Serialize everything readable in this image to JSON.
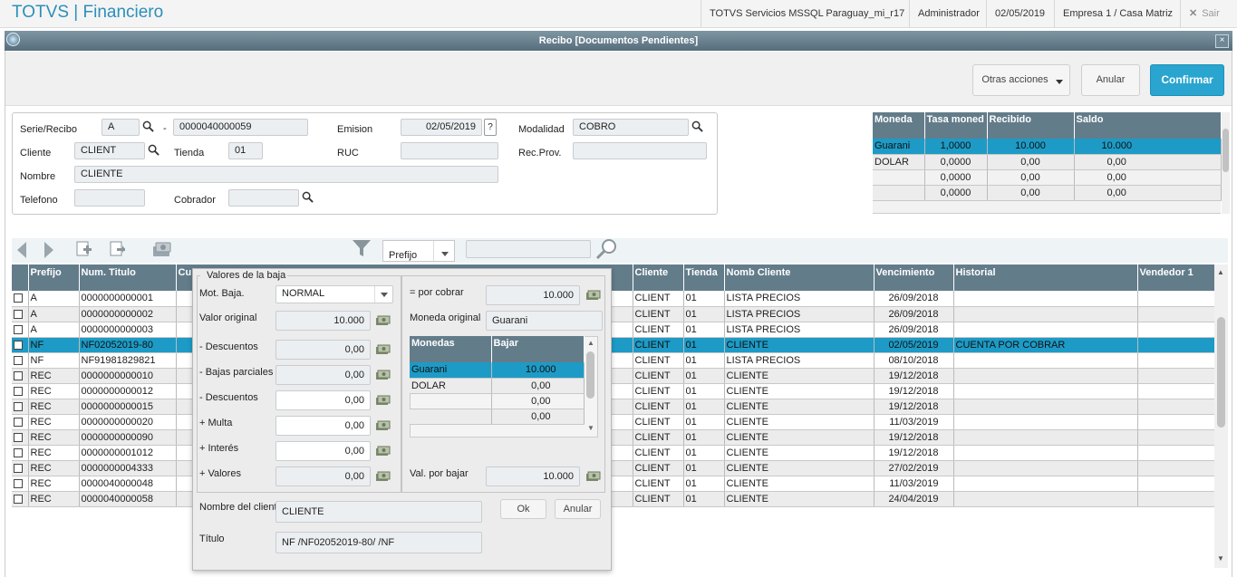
{
  "topbar": {
    "app_title": "TOTVS | Financiero",
    "server": "TOTVS Servicios MSSQL Paraguay_mi_r17",
    "user": "Administrador",
    "date": "02/05/2019",
    "company": "Empresa 1 / Casa Matriz",
    "exit": "Sair"
  },
  "window": {
    "title": "Recibo [Documentos Pendientes]"
  },
  "actions": {
    "other": "Otras acciones",
    "cancel": "Anular",
    "confirm": "Confirmar"
  },
  "form": {
    "serie_label": "Serie/Recibo",
    "serie": "A",
    "dash": "-",
    "recibo": "0000040000059",
    "emision_label": "Emision",
    "emision": "02/05/2019",
    "help": "?",
    "modalidad_label": "Modalidad",
    "modalidad": "COBRO",
    "cliente_label": "Cliente",
    "cliente": "CLIENT",
    "tienda_label": "Tienda",
    "tienda": "01",
    "ruc_label": "RUC",
    "ruc": "",
    "recprov_label": "Rec.Prov.",
    "recprov": "",
    "nombre_label": "Nombre",
    "nombre": "CLIENTE",
    "telefono_label": "Telefono",
    "telefono": "",
    "cobrador_label": "Cobrador",
    "cobrador": ""
  },
  "currency": {
    "headers": [
      "Moneda",
      "Tasa moned",
      "Recibido",
      "Saldo"
    ],
    "rows": [
      [
        "Guarani",
        "1,0000",
        "10.000",
        "10.000"
      ],
      [
        "DOLAR",
        "0,0000",
        "0,00",
        "0,00"
      ],
      [
        "",
        "0,0000",
        "0,00",
        "0,00"
      ],
      [
        "",
        "0,0000",
        "0,00",
        "0,00"
      ]
    ]
  },
  "toolbar": {
    "filter_field": "Prefijo",
    "search": ""
  },
  "grid": {
    "headers": [
      "",
      "Prefijo",
      "Num. Titulo",
      "Cu",
      "Cliente",
      "Tienda",
      "Nomb Cliente",
      "Vencimiento",
      "Historial",
      "Vendedor 1"
    ],
    "rows": [
      [
        "A",
        "0000000000001",
        "CLIENT",
        "01",
        "LISTA PRECIOS",
        "26/09/2018",
        ""
      ],
      [
        "A",
        "0000000000002",
        "CLIENT",
        "01",
        "LISTA PRECIOS",
        "26/09/2018",
        ""
      ],
      [
        "A",
        "0000000000003",
        "CLIENT",
        "01",
        "LISTA PRECIOS",
        "26/09/2018",
        ""
      ],
      [
        "NF",
        "NF02052019-80",
        "CLIENT",
        "01",
        "CLIENTE",
        "02/05/2019",
        "CUENTA POR COBRAR"
      ],
      [
        "NF",
        "NF91981829821",
        "CLIENT",
        "01",
        "LISTA PRECIOS",
        "08/10/2018",
        ""
      ],
      [
        "REC",
        "0000000000010",
        "CLIENT",
        "01",
        "CLIENTE",
        "19/12/2018",
        ""
      ],
      [
        "REC",
        "0000000000012",
        "CLIENT",
        "01",
        "CLIENTE",
        "19/12/2018",
        ""
      ],
      [
        "REC",
        "0000000000015",
        "CLIENT",
        "01",
        "CLIENTE",
        "19/12/2018",
        ""
      ],
      [
        "REC",
        "0000000000020",
        "CLIENT",
        "01",
        "CLIENTE",
        "11/03/2019",
        ""
      ],
      [
        "REC",
        "0000000000090",
        "CLIENT",
        "01",
        "CLIENTE",
        "19/12/2018",
        ""
      ],
      [
        "REC",
        "0000000001012",
        "CLIENT",
        "01",
        "CLIENTE",
        "19/12/2018",
        ""
      ],
      [
        "REC",
        "0000000004333",
        "CLIENT",
        "01",
        "CLIENTE",
        "27/02/2019",
        ""
      ],
      [
        "REC",
        "0000040000048",
        "CLIENT",
        "01",
        "CLIENTE",
        "11/03/2019",
        ""
      ],
      [
        "REC",
        "0000040000058",
        "CLIENT",
        "01",
        "CLIENTE",
        "24/04/2019",
        ""
      ]
    ]
  },
  "dialog": {
    "group_title": "Valores de la baja",
    "mot_label": "Mot. Baja.",
    "mot": "NORMAL",
    "orig_label": "Valor original",
    "orig": "10.000",
    "desc1_label": "- Descuentos",
    "desc1": "0,00",
    "bajas_label": "- Bajas parciales",
    "bajas": "0,00",
    "desc2_label": "- Descuentos",
    "desc2": "0,00",
    "multa_label": "+ Multa",
    "multa": "0,00",
    "interes_label": "+ Interés",
    "interes": "0,00",
    "valores_label": "+ Valores",
    "valores": "0,00",
    "porcobrar_label": "= por cobrar",
    "porcobrar": "10.000",
    "moneda_label": "Moneda original",
    "moneda": "Guarani",
    "mon_headers": [
      "Monedas",
      "Bajar"
    ],
    "mon_rows": [
      [
        "Guarani",
        "10.000"
      ],
      [
        "DOLAR",
        "0,00"
      ],
      [
        "",
        "0,00"
      ],
      [
        "",
        "0,00"
      ]
    ],
    "valbajar_label": "Val. por bajar",
    "valbajar": "10.000",
    "nombre_label": "Nombre del cliente",
    "nombre": "CLIENTE",
    "titulo_label": "Título",
    "titulo": "NF /NF02052019-80/  /NF",
    "ok": "Ok",
    "cancel": "Anular"
  }
}
